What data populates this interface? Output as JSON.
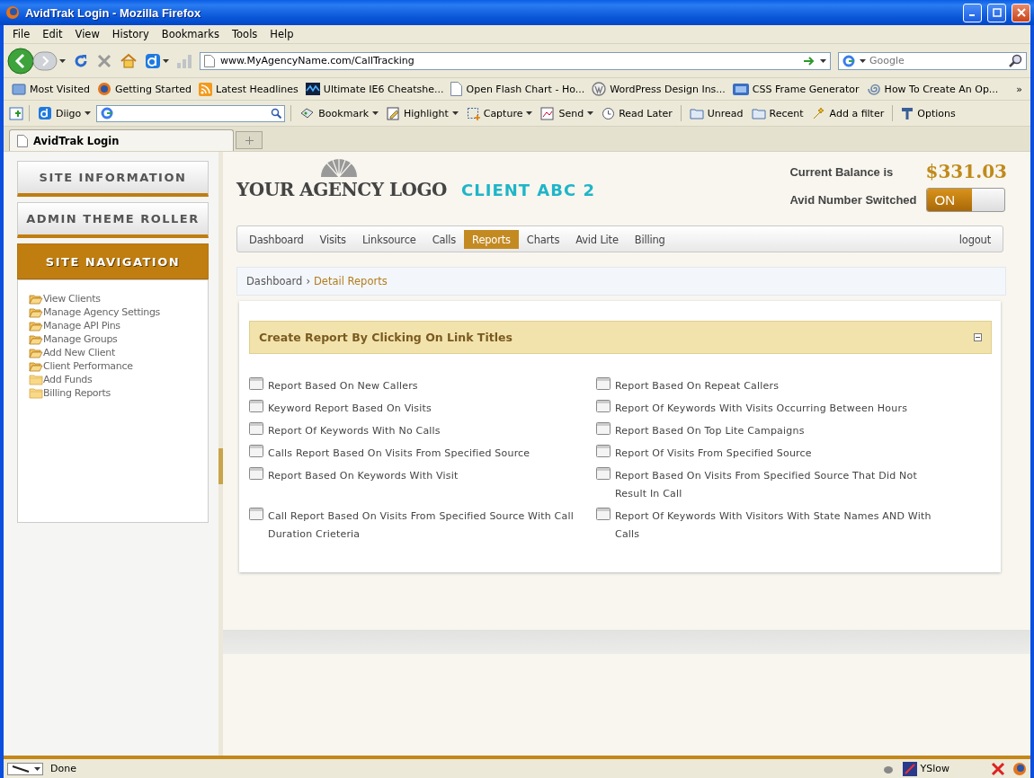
{
  "window": {
    "title": "AvidTrak Login - Mozilla Firefox"
  },
  "menu_bar": [
    "File",
    "Edit",
    "View",
    "History",
    "Bookmarks",
    "Tools",
    "Help"
  ],
  "address_bar": {
    "value": "www.MyAgencyName.com/CallTracking"
  },
  "search_box": {
    "placeholder": "Google"
  },
  "bookmarks": [
    "Most Visited",
    "Getting Started",
    "Latest Headlines",
    "Ultimate IE6 Cheatshe...",
    "Open Flash Chart - Ho...",
    "WordPress Design Ins...",
    "CSS Frame Generator",
    "How To Create An Op..."
  ],
  "bookmarks_overflow": "»",
  "diigo_toolbar": {
    "brand": "Diigo",
    "items": [
      {
        "label": "Bookmark",
        "kind": "menu"
      },
      {
        "label": "Highlight",
        "kind": "menu"
      },
      {
        "label": "Capture",
        "kind": "menu"
      },
      {
        "label": "Send",
        "kind": "menu"
      },
      {
        "label": "Read Later",
        "kind": "plain"
      },
      {
        "label": "Unread",
        "kind": "plain"
      },
      {
        "label": "Recent",
        "kind": "plain"
      },
      {
        "label": "Add a filter",
        "kind": "plain"
      },
      {
        "label": "Options",
        "kind": "plain"
      }
    ]
  },
  "tabs": [
    {
      "label": "AvidTrak Login",
      "selected": true
    }
  ],
  "sidebar": {
    "sections": [
      {
        "label": "SITE INFORMATION",
        "selected": false
      },
      {
        "label": "ADMIN THEME ROLLER",
        "selected": false
      },
      {
        "label": "SITE NAVIGATION",
        "selected": true
      }
    ],
    "items": [
      {
        "label": "View Clients",
        "kind": "open"
      },
      {
        "label": "Manage Agency Settings",
        "kind": "open"
      },
      {
        "label": "Manage API Pins",
        "kind": "open"
      },
      {
        "label": "Manage Groups",
        "kind": "open"
      },
      {
        "label": "Add New Client",
        "kind": "open"
      },
      {
        "label": "Client Performance",
        "kind": "open"
      },
      {
        "label": "Add Funds",
        "kind": "closed"
      },
      {
        "label": "Billing Reports",
        "kind": "closed"
      }
    ]
  },
  "header": {
    "logo": "YOUR AGENCY LOGO",
    "client": "CLIENT ABC 2",
    "balance_label": "Current Balance is",
    "balance": "$331.03",
    "switch_label": "Avid Number Switched",
    "switch": {
      "label": "ON",
      "on": true
    }
  },
  "nav": {
    "items": [
      {
        "label": "Dashboard",
        "selected": false
      },
      {
        "label": "Visits",
        "selected": false
      },
      {
        "label": "Linksource",
        "selected": false
      },
      {
        "label": "Calls",
        "selected": false
      },
      {
        "label": "Reports",
        "selected": true
      },
      {
        "label": "Charts",
        "selected": false
      },
      {
        "label": "Avid Lite",
        "selected": false
      },
      {
        "label": "Billing",
        "selected": false
      }
    ],
    "logout": "logout"
  },
  "breadcrumb": {
    "items": [
      {
        "label": "Dashboard",
        "selected": false
      },
      {
        "label": "Detail Reports",
        "selected": true
      }
    ],
    "separator": "›"
  },
  "panel": {
    "title": "Create Report By Clicking On Link Titles",
    "expanded": true,
    "reports": [
      "Report Based On New Callers",
      "Report Based On Repeat Callers",
      "Keyword Report Based On Visits",
      "Report Of Keywords With Visits Occurring Between Hours",
      "Report Of Keywords With No Calls",
      "Report Based On Top Lite Campaigns",
      "Calls Report Based On Visits From Specified Source",
      "Report Of Visits From Specified Source",
      "Report Based On Keywords With Visit",
      "Report Based On Visits From Specified Source That Did Not Result In Call",
      "Call Report Based On Visits From Specified Source With Call Duration Crieteria",
      "Report Of Keywords With Visitors With State Names AND With Calls"
    ]
  },
  "status_bar": {
    "text": "Done",
    "yslow": "YSlow"
  }
}
